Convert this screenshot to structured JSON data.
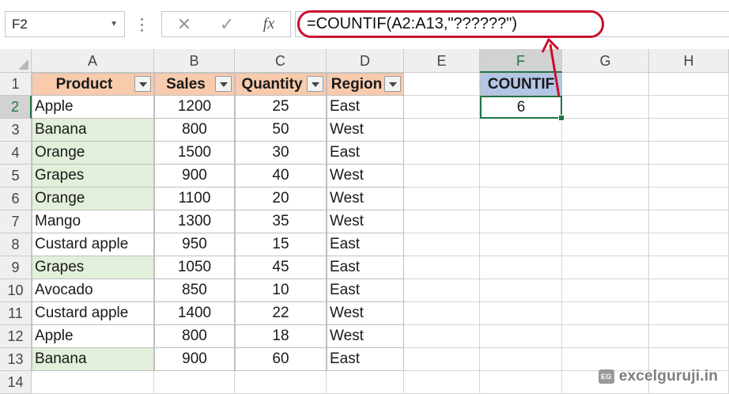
{
  "name_box": "F2",
  "formula_bar": {
    "cancel_icon": "✕",
    "enter_icon": "✓",
    "fx_label": "fx",
    "formula": "=COUNTIF(A2:A13,\"??????\")"
  },
  "columns": [
    "A",
    "B",
    "C",
    "D",
    "E",
    "F",
    "G",
    "H"
  ],
  "rows": [
    "1",
    "2",
    "3",
    "4",
    "5",
    "6",
    "7",
    "8",
    "9",
    "10",
    "11",
    "12",
    "13",
    "14"
  ],
  "table": {
    "headers": [
      "Product",
      "Sales",
      "Quantity",
      "Region"
    ],
    "records": [
      {
        "product": "Apple",
        "sales": "1200",
        "quantity": "25",
        "region": "East",
        "highlight": false
      },
      {
        "product": "Banana",
        "sales": "800",
        "quantity": "50",
        "region": "West",
        "highlight": true
      },
      {
        "product": "Orange",
        "sales": "1500",
        "quantity": "30",
        "region": "East",
        "highlight": true
      },
      {
        "product": "Grapes",
        "sales": "900",
        "quantity": "40",
        "region": "West",
        "highlight": true
      },
      {
        "product": "Orange",
        "sales": "1100",
        "quantity": "20",
        "region": "West",
        "highlight": true
      },
      {
        "product": "Mango",
        "sales": "1300",
        "quantity": "35",
        "region": "West",
        "highlight": false
      },
      {
        "product": "Custard apple",
        "sales": "950",
        "quantity": "15",
        "region": "East",
        "highlight": false
      },
      {
        "product": "Grapes",
        "sales": "1050",
        "quantity": "45",
        "region": "East",
        "highlight": true
      },
      {
        "product": "Avocado",
        "sales": "850",
        "quantity": "10",
        "region": "East",
        "highlight": false
      },
      {
        "product": "Custard apple",
        "sales": "1400",
        "quantity": "22",
        "region": "West",
        "highlight": false
      },
      {
        "product": "Apple",
        "sales": "800",
        "quantity": "18",
        "region": "West",
        "highlight": false
      },
      {
        "product": "Banana",
        "sales": "900",
        "quantity": "60",
        "region": "East",
        "highlight": true
      }
    ]
  },
  "countif": {
    "header": "COUNTIF",
    "value": "6"
  },
  "selected": {
    "column": "F",
    "row": "2"
  },
  "colors": {
    "header_fill": "#f8cbad",
    "highlight_fill": "#e2efda",
    "countif_fill": "#b4c6e7",
    "annotation": "#c8102e",
    "selection": "#217346"
  },
  "watermark": {
    "logo": "EG",
    "text": "excelguruji.in"
  }
}
